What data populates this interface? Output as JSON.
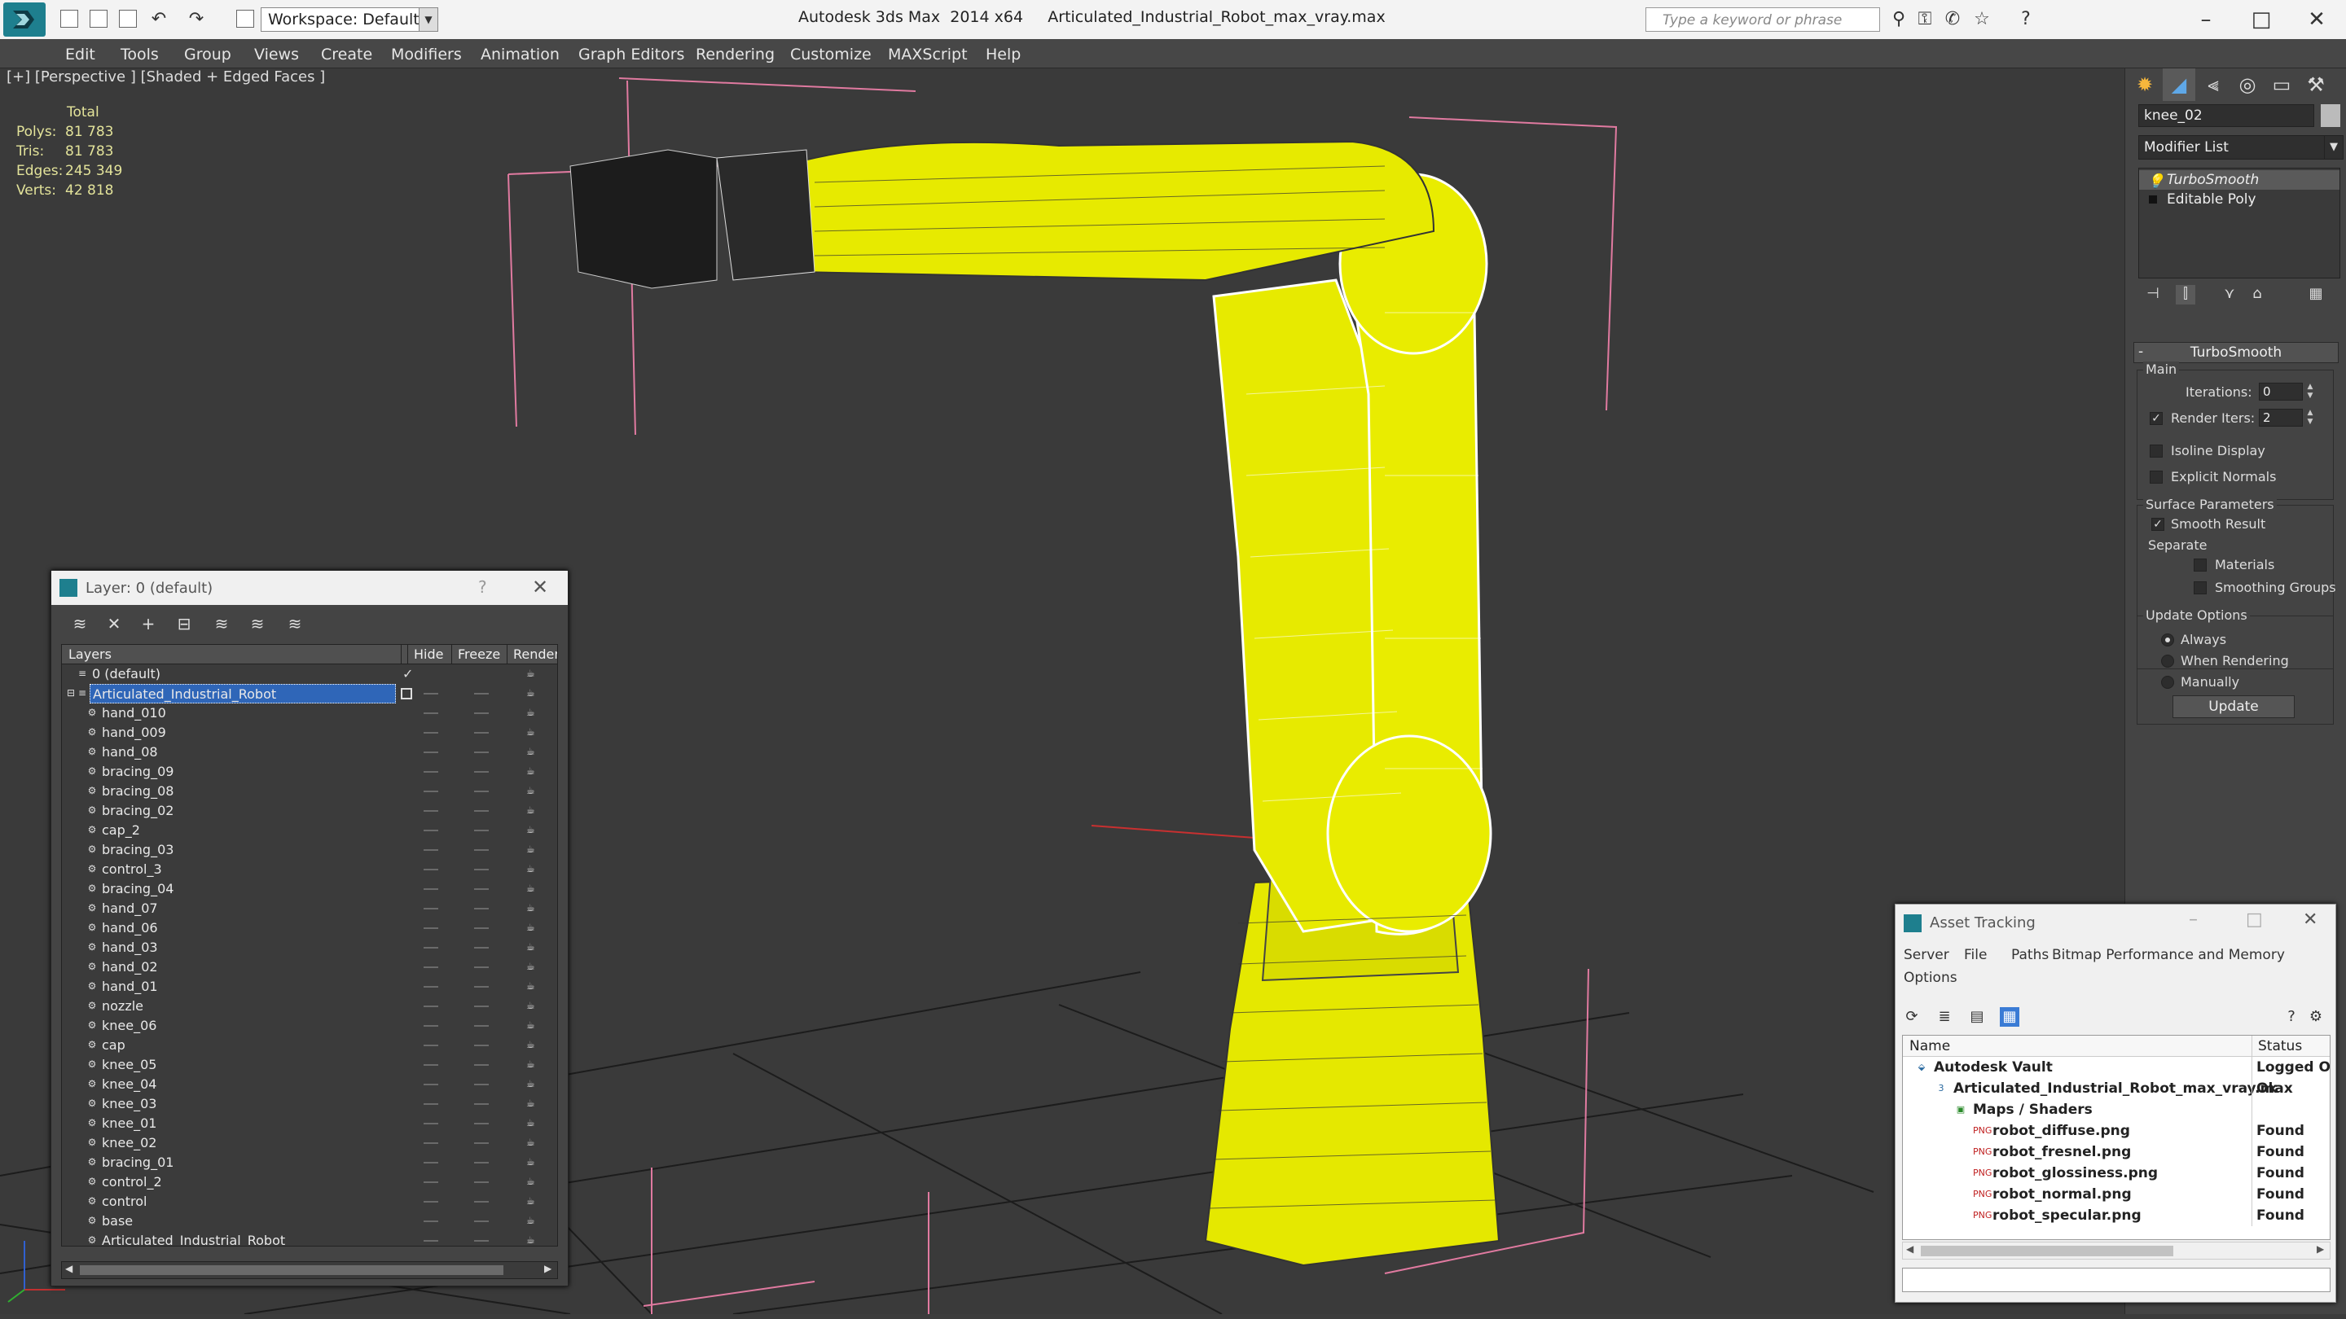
{
  "titlebar": {
    "workspace": "Workspace: Default",
    "title": "Autodesk 3ds Max  2014 x64     Articulated_Industrial_Robot_max_vray.max",
    "search_placeholder": "Type a keyword or phrase"
  },
  "menu": [
    "Edit",
    "Tools",
    "Group",
    "Views",
    "Create",
    "Modifiers",
    "Animation",
    "Graph Editors",
    "Rendering",
    "Customize",
    "MAXScript",
    "Help"
  ],
  "viewport": {
    "label": "[+] [Perspective ] [Shaded + Edged Faces ]",
    "stats": {
      "header": "Total",
      "rows": [
        {
          "key": "Polys:",
          "value": "81 783"
        },
        {
          "key": "Tris:",
          "value": "81 783"
        },
        {
          "key": "Edges:",
          "value": "245 349"
        },
        {
          "key": "Verts:",
          "value": "42 818"
        }
      ]
    },
    "model_color": "#e7ea00",
    "wire_color": "#ffffff"
  },
  "command_panel": {
    "object_name": "knee_02",
    "modifier_list": "Modifier List",
    "stack": [
      "TurboSmooth",
      "Editable Poly"
    ],
    "rollout_title": "TurboSmooth",
    "main_group": "Main",
    "iterations_label": "Iterations:",
    "iterations_value": "0",
    "render_iters_label": "Render Iters:",
    "render_iters_value": "2",
    "isoline_display": "Isoline Display",
    "explicit_normals": "Explicit Normals",
    "surface_params": "Surface Parameters",
    "smooth_result": "Smooth Result",
    "separate": "Separate",
    "materials": "Materials",
    "smoothing_groups": "Smoothing Groups",
    "update_options": "Update Options",
    "always": "Always",
    "when_rendering": "When Rendering",
    "manually": "Manually",
    "update_button": "Update"
  },
  "layer_dialog": {
    "title": "Layer: 0 (default)",
    "help": "?",
    "columns": [
      "Layers",
      "Hide",
      "Freeze",
      "Render"
    ],
    "layers": [
      {
        "name": "0 (default)",
        "level": 0,
        "type": "layer",
        "current": true
      },
      {
        "name": "Articulated_Industrial_Robot",
        "level": 0,
        "type": "layer",
        "selected": true
      },
      {
        "name": "hand_010",
        "level": 1,
        "type": "object"
      },
      {
        "name": "hand_009",
        "level": 1,
        "type": "object"
      },
      {
        "name": "hand_08",
        "level": 1,
        "type": "object"
      },
      {
        "name": "bracing_09",
        "level": 1,
        "type": "object"
      },
      {
        "name": "bracing_08",
        "level": 1,
        "type": "object"
      },
      {
        "name": "bracing_02",
        "level": 1,
        "type": "object"
      },
      {
        "name": "cap_2",
        "level": 1,
        "type": "object"
      },
      {
        "name": "bracing_03",
        "level": 1,
        "type": "object"
      },
      {
        "name": "control_3",
        "level": 1,
        "type": "object"
      },
      {
        "name": "bracing_04",
        "level": 1,
        "type": "object"
      },
      {
        "name": "hand_07",
        "level": 1,
        "type": "object"
      },
      {
        "name": "hand_06",
        "level": 1,
        "type": "object"
      },
      {
        "name": "hand_03",
        "level": 1,
        "type": "object"
      },
      {
        "name": "hand_02",
        "level": 1,
        "type": "object"
      },
      {
        "name": "hand_01",
        "level": 1,
        "type": "object"
      },
      {
        "name": "nozzle",
        "level": 1,
        "type": "object"
      },
      {
        "name": "knee_06",
        "level": 1,
        "type": "object"
      },
      {
        "name": "cap",
        "level": 1,
        "type": "object"
      },
      {
        "name": "knee_05",
        "level": 1,
        "type": "object"
      },
      {
        "name": "knee_04",
        "level": 1,
        "type": "object"
      },
      {
        "name": "knee_03",
        "level": 1,
        "type": "object"
      },
      {
        "name": "knee_01",
        "level": 1,
        "type": "object"
      },
      {
        "name": "knee_02",
        "level": 1,
        "type": "object"
      },
      {
        "name": "bracing_01",
        "level": 1,
        "type": "object"
      },
      {
        "name": "control_2",
        "level": 1,
        "type": "object"
      },
      {
        "name": "control",
        "level": 1,
        "type": "object"
      },
      {
        "name": "base",
        "level": 1,
        "type": "object"
      },
      {
        "name": "Articulated_Industrial_Robot",
        "level": 1,
        "type": "object"
      }
    ]
  },
  "asset_dialog": {
    "title": "Asset Tracking",
    "menu": [
      "Server",
      "File",
      "Paths",
      "Bitmap Performance and Memory",
      "Options"
    ],
    "columns": [
      "Name",
      "Status"
    ],
    "rows": [
      {
        "name": "Autodesk Vault",
        "status": "Logged Out",
        "level": 0,
        "icon": "vault"
      },
      {
        "name": "Articulated_Industrial_Robot_max_vray.max",
        "status": "Ok",
        "level": 1,
        "icon": "max"
      },
      {
        "name": "Maps / Shaders",
        "status": "",
        "level": 2,
        "icon": "maps"
      },
      {
        "name": "robot_diffuse.png",
        "status": "Found",
        "level": 3,
        "icon": "png"
      },
      {
        "name": "robot_fresnel.png",
        "status": "Found",
        "level": 3,
        "icon": "png"
      },
      {
        "name": "robot_glossiness.png",
        "status": "Found",
        "level": 3,
        "icon": "png"
      },
      {
        "name": "robot_normal.png",
        "status": "Found",
        "level": 3,
        "icon": "png"
      },
      {
        "name": "robot_specular.png",
        "status": "Found",
        "level": 3,
        "icon": "png"
      }
    ]
  }
}
